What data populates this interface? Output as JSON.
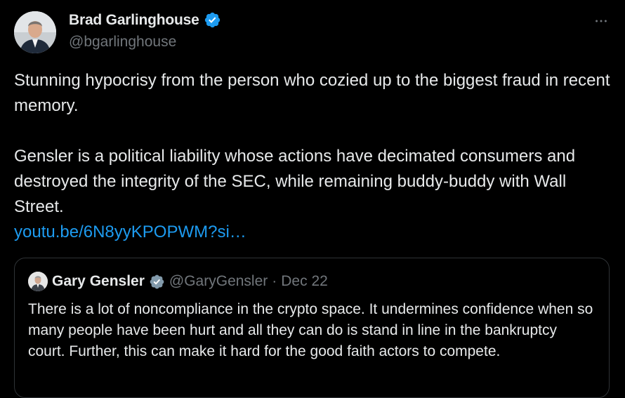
{
  "author": {
    "display_name": "Brad Garlinghouse",
    "handle": "@bgarlinghouse",
    "verified_icon": "verified-badge-icon",
    "avatar": "avatar"
  },
  "more_label": "···",
  "tweet": {
    "paragraph_1": "Stunning hypocrisy from the person who cozied up to the biggest fraud in recent memory.",
    "paragraph_2": "Gensler is a political liability whose actions have decimated consumers and destroyed the integrity of the SEC, while remaining buddy-buddy with Wall Street.",
    "link": "youtu.be/6N8yyKPOPWM?si…"
  },
  "quoted": {
    "display_name": "Gary Gensler",
    "handle": "@GaryGensler",
    "separator": "·",
    "date": "Dec 22",
    "text": "There is a lot of noncompliance in the crypto space. It undermines confidence when so many people have been hurt and all they can do is stand in line in the bankruptcy court. Further, this can make it hard for the good faith actors to compete."
  },
  "colors": {
    "background": "#000000",
    "text": "#e7e9ea",
    "secondary": "#71767b",
    "link": "#1d9bf0",
    "verified": "#1d9bf0",
    "border": "#2f3336"
  }
}
